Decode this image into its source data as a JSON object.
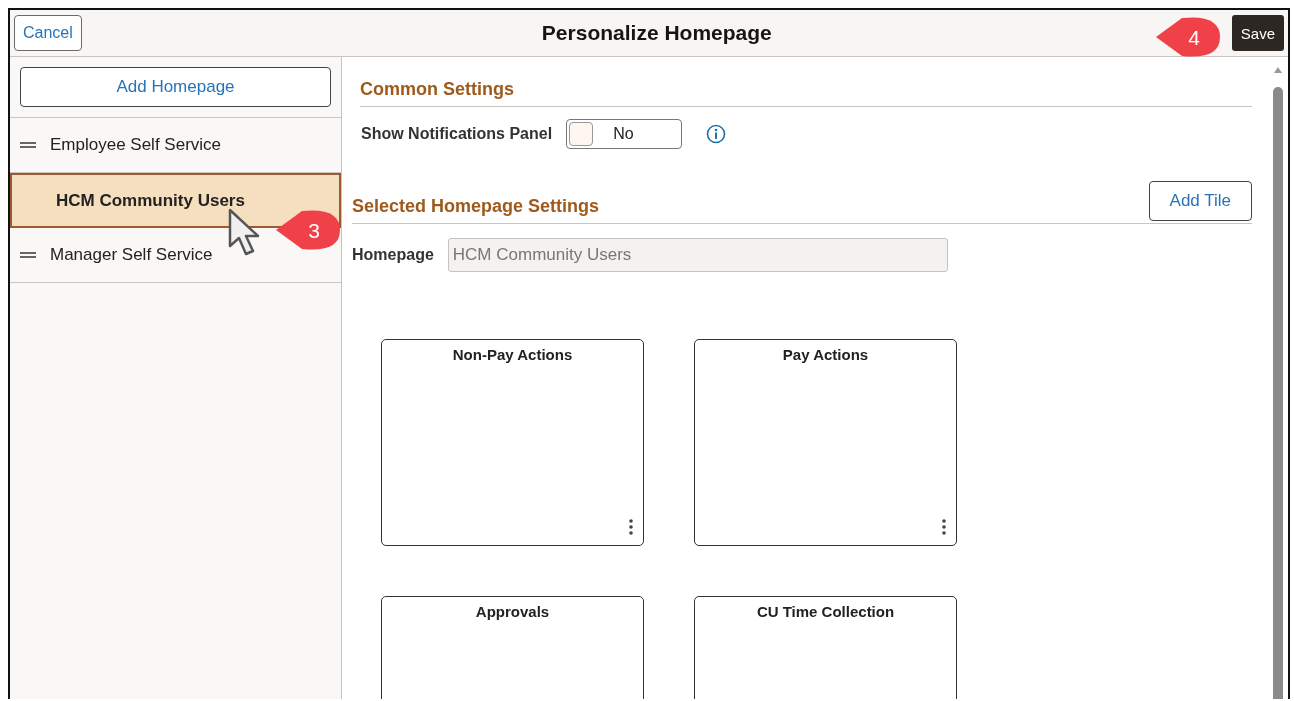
{
  "header": {
    "title": "Personalize Homepage",
    "cancel": "Cancel",
    "save": "Save"
  },
  "sidebar": {
    "add_button": "Add Homepage",
    "items": [
      {
        "label": "Employee Self Service",
        "selected": false
      },
      {
        "label": "HCM Community Users",
        "selected": true
      },
      {
        "label": "Manager Self Service",
        "selected": false
      }
    ]
  },
  "common_settings": {
    "title": "Common Settings",
    "notifications": {
      "label": "Show Notifications Panel",
      "value": "No",
      "on": false
    }
  },
  "selected_settings": {
    "title": "Selected Homepage Settings",
    "add_tile": "Add Tile",
    "homepage_label": "Homepage",
    "homepage_value": "HCM Community Users"
  },
  "tiles": [
    {
      "title": "Non-Pay Actions"
    },
    {
      "title": "Pay Actions"
    },
    {
      "title": "Approvals"
    },
    {
      "title": "CU Time Collection"
    }
  ],
  "callouts": [
    {
      "number": "3"
    },
    {
      "number": "4"
    }
  ]
}
